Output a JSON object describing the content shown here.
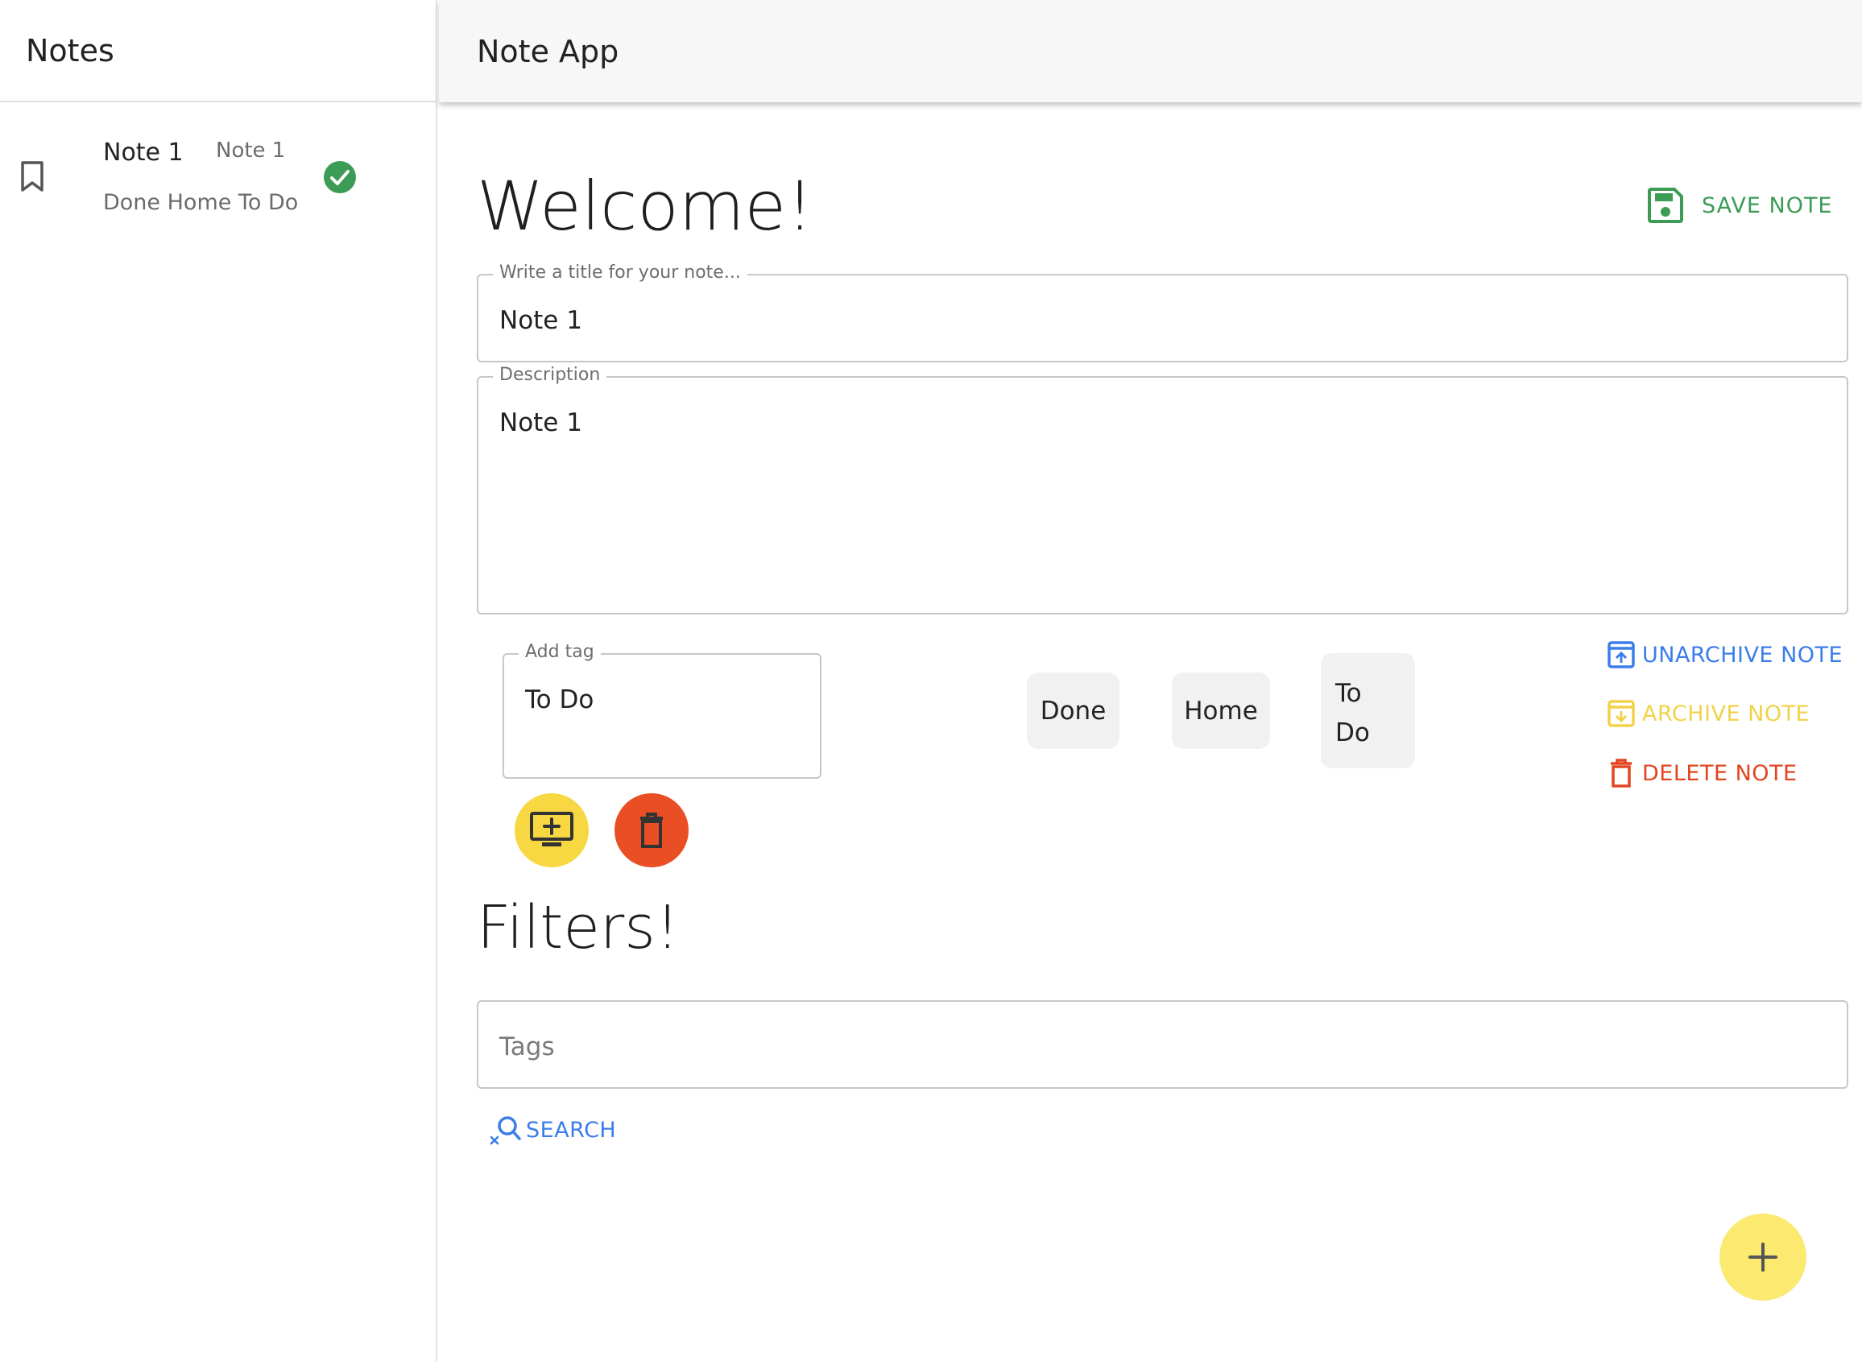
{
  "sidebar": {
    "title": "Notes",
    "notes": [
      {
        "title": "Note 1",
        "description": "Note 1",
        "tags": "Done Home To Do",
        "status": "done"
      }
    ]
  },
  "appbar": {
    "title": "Note App"
  },
  "main": {
    "heading": "Welcome!",
    "save_label": "SAVE NOTE",
    "title_field": {
      "label": "Write a title for your note...",
      "value": "Note 1"
    },
    "description_field": {
      "label": "Description",
      "value": "Note 1"
    },
    "tag_field": {
      "label": "Add tag",
      "value": "To Do"
    },
    "chips": [
      "Done",
      "Home",
      "To Do"
    ],
    "actions": {
      "unarchive": "UNARCHIVE NOTE",
      "archive": "ARCHIVE NOTE",
      "delete": "DELETE NOTE"
    },
    "filters_heading": "Filters!",
    "filters_field": {
      "placeholder": "Tags"
    },
    "search_label": "SEARCH"
  },
  "colors": {
    "green": "#3c9b55",
    "blue": "#3b7de9",
    "yellow": "#f7d843",
    "red": "#e94e24",
    "fab": "#fbe970"
  },
  "icons": {
    "bookmark": "bookmark-icon",
    "check": "check-circle-icon",
    "save": "save-icon",
    "add_tag": "add-to-queue-icon",
    "delete_tag": "delete-icon",
    "unarchive": "unarchive-icon",
    "archive": "archive-icon",
    "delete_note": "delete-icon",
    "search": "search-off-icon",
    "add": "plus-icon"
  }
}
